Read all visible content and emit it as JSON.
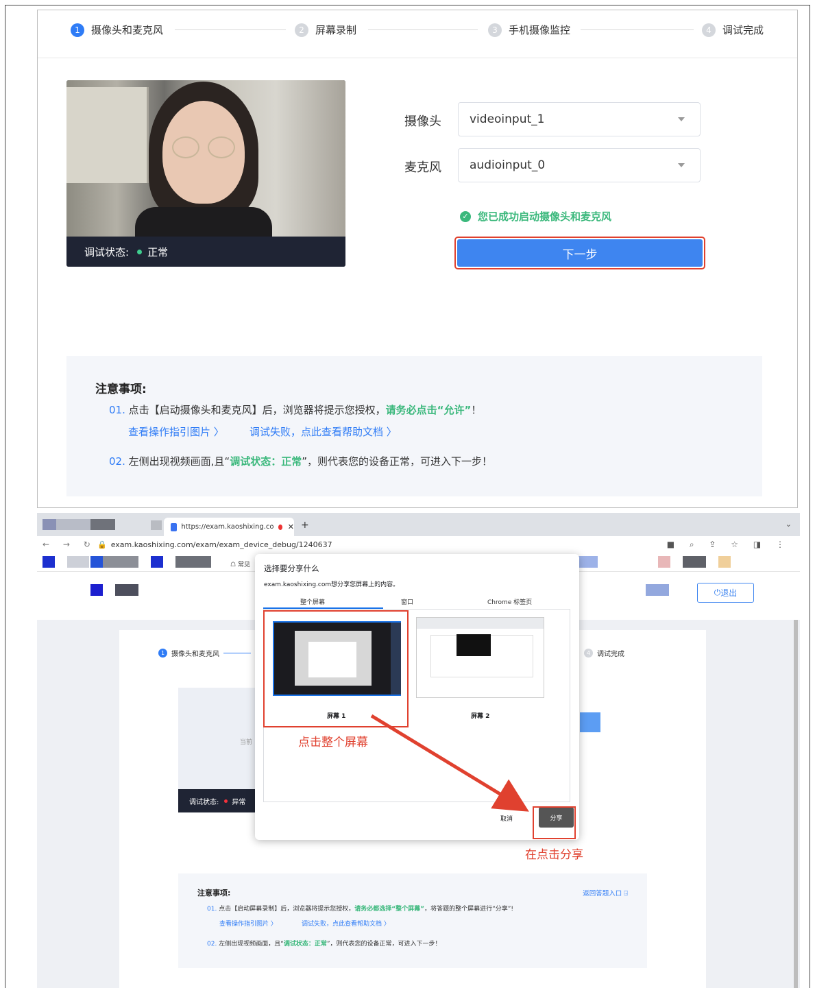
{
  "top": {
    "steps": [
      {
        "num": "1",
        "label": "摄像头和麦克风"
      },
      {
        "num": "2",
        "label": "屏幕录制"
      },
      {
        "num": "3",
        "label": "手机摄像监控"
      },
      {
        "num": "4",
        "label": "调试完成"
      }
    ],
    "video_status_label": "调试状态:",
    "video_status_value": "正常",
    "camera_label": "摄像头",
    "camera_value": "videoinput_1",
    "mic_label": "麦克风",
    "mic_value": "audioinput_0",
    "success_msg": "您已成功启动摄像头和麦克风",
    "next_button": "下一步",
    "notice": {
      "title": "注意事项:",
      "item1_num": "01.",
      "item1_text": "点击【启动摄像头和麦克风】后，浏览器将提示您授权，",
      "item1_highlight": "请务必点击“允许”",
      "item1_end": "！",
      "link_guide": "查看操作指引图片 〉",
      "link_help": "调试失败，点此查看帮助文档 〉",
      "item2_num": "02.",
      "item2_text": "左侧出现视频画面,且“",
      "item2_highlight": "调试状态：正常",
      "item2_end": "”，则代表您的设备正常，可进入下一步！"
    }
  },
  "browser": {
    "tab_title": "https://exam.kaoshixing.co",
    "url": "exam.kaoshixing.com/exam/exam_device_debug/1240637",
    "bookmark": "常见",
    "exit_button": "退出",
    "mini_steps": [
      {
        "num": "1",
        "label": "摄像头和麦克风"
      },
      {
        "num": "4",
        "label": "调试完成"
      }
    ],
    "mini_current": "当前",
    "mini_status_label": "调试状态:",
    "mini_status_value": "异常",
    "mini_notice": {
      "title": "注意事项:",
      "back_link": "返回答题入口 ⍈",
      "l1_num": "01.",
      "l1_a": "点击【启动屏幕录制】后，浏览器将提示您授权，",
      "l1_b": "请务必都选择“整个屏幕”",
      "l1_c": "，将答题的整个屏幕进行“分享”!",
      "link_guide": "查看操作指引图片 〉",
      "link_help": "调试失败，点此查看帮助文档 〉",
      "l2_num": "02.",
      "l2_a": "左侧出现视频画面，且“",
      "l2_b": "调试状态：正常",
      "l2_c": "”，则代表您的设备正常，可进入下一步！"
    },
    "dialog": {
      "title": "选择要分享什么",
      "subtitle": "exam.kaoshixing.com想分享您屏幕上的内容。",
      "tabs": [
        "整个屏幕",
        "窗口",
        "Chrome 标签页"
      ],
      "screen1": "屏幕 1",
      "screen2": "屏幕 2",
      "cancel": "取消",
      "share": "分享"
    },
    "annotation_1": "点击整个屏幕",
    "annotation_2": "在点击分享"
  },
  "colors": {
    "accent": "#3e85f0",
    "success": "#3bb87c",
    "annotation": "#e0412f"
  }
}
